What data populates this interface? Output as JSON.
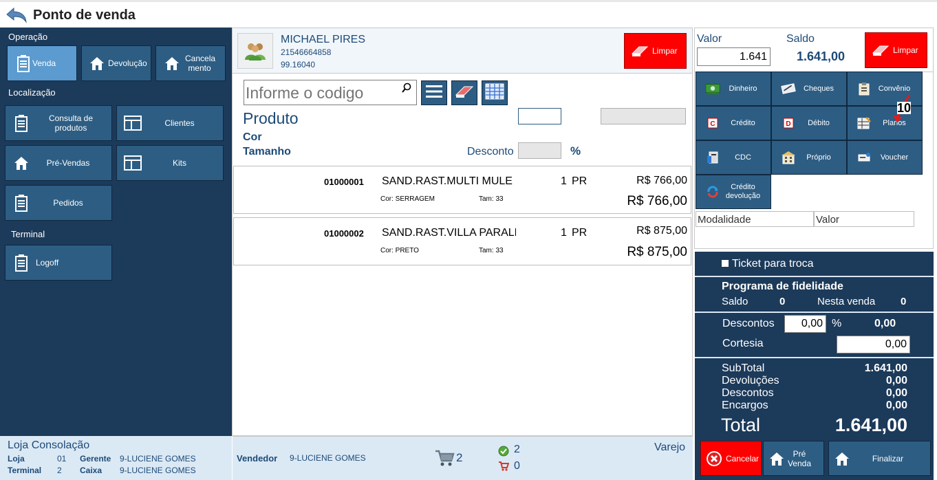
{
  "header": {
    "title": "Ponto de venda"
  },
  "sidebar": {
    "operacao_title": "Operação",
    "localizacao_title": "Localização",
    "terminal_title": "Terminal",
    "ops": [
      "Venda",
      "Devolução",
      "Cancela mento"
    ],
    "loc": [
      "Consulta de produtos",
      "Clientes",
      "Pré-Vendas",
      "Kits",
      "Pedidos"
    ],
    "term": [
      "Logoff"
    ]
  },
  "customer": {
    "name": "MICHAEL PIRES",
    "phone": "21546664858",
    "code": "99.16040",
    "clear_label": "Limpar"
  },
  "search": {
    "placeholder": "Informe o codigo"
  },
  "product": {
    "title": "Produto",
    "cor_label": "Cor",
    "tamanho_label": "Tamanho",
    "desconto_label": "Desconto",
    "percent": "%"
  },
  "items": [
    {
      "code": "01000001",
      "desc": "SAND.RAST.MULTI MULE C",
      "qty": "1",
      "unit": "PR",
      "unit_price": "R$ 766,00",
      "total": "R$ 766,00",
      "cor": "Cor: SERRAGEM",
      "tam": "Tam: 33"
    },
    {
      "code": "01000002",
      "desc": "SAND.RAST.VILLA PARALE",
      "qty": "1",
      "unit": "PR",
      "unit_price": "R$ 875,00",
      "total": "R$ 875,00",
      "cor": "Cor: PRETO",
      "tam": "Tam: 33"
    }
  ],
  "payment": {
    "valor_label": "Valor",
    "saldo_label": "Saldo",
    "valor_value": "1.641",
    "saldo_value": "1.641,00",
    "clear_label": "Limpar",
    "methods": [
      "Dinheiro",
      "Cheques",
      "Convênio",
      "Crédito",
      "Débito",
      "Planos",
      "CDC",
      "Próprio",
      "Voucher",
      "Crédito devolução"
    ],
    "annotation": "10",
    "modalidade_header": "Modalidade",
    "valor_header": "Valor"
  },
  "summary": {
    "ticket_label": "Ticket para troca",
    "fidelidade_title": "Programa de fidelidade",
    "saldo_label": "Saldo",
    "saldo_value": "0",
    "nesta_venda_label": "Nesta venda",
    "nesta_venda_value": "0",
    "descontos_label": "Descontos",
    "descontos_input": "0,00",
    "descontos_percent": "%",
    "descontos_value": "0,00",
    "cortesia_label": "Cortesia",
    "cortesia_input": "0,00",
    "subtotal_label": "SubTotal",
    "subtotal_value": "1.641,00",
    "devolucoes_label": "Devoluções",
    "devolucoes_value": "0,00",
    "descontos2_label": "Descontos",
    "descontos2_value": "0,00",
    "encargos_label": "Encargos",
    "encargos_value": "0,00",
    "total_label": "Total",
    "total_value": "1.641,00"
  },
  "actions": {
    "cancel": "Cancelar",
    "prevenda": "Pré Venda",
    "finalizar": "Finalizar"
  },
  "footer": {
    "store_name": "Loja Consolação",
    "loja_label": "Loja",
    "loja_value": "01",
    "gerente_label": "Gerente",
    "gerente_value": "9-LUCIENE GOMES",
    "terminal_label": "Terminal",
    "terminal_value": "2",
    "caixa_label": "Caixa",
    "caixa_value": "9-LUCIENE GOMES",
    "vendedor_label": "Vendedor",
    "vendedor_value": "9-LUCIENE GOMES",
    "cart_count": "2",
    "ok_count": "2",
    "cart2_count": "0",
    "varejo": "Varejo"
  }
}
